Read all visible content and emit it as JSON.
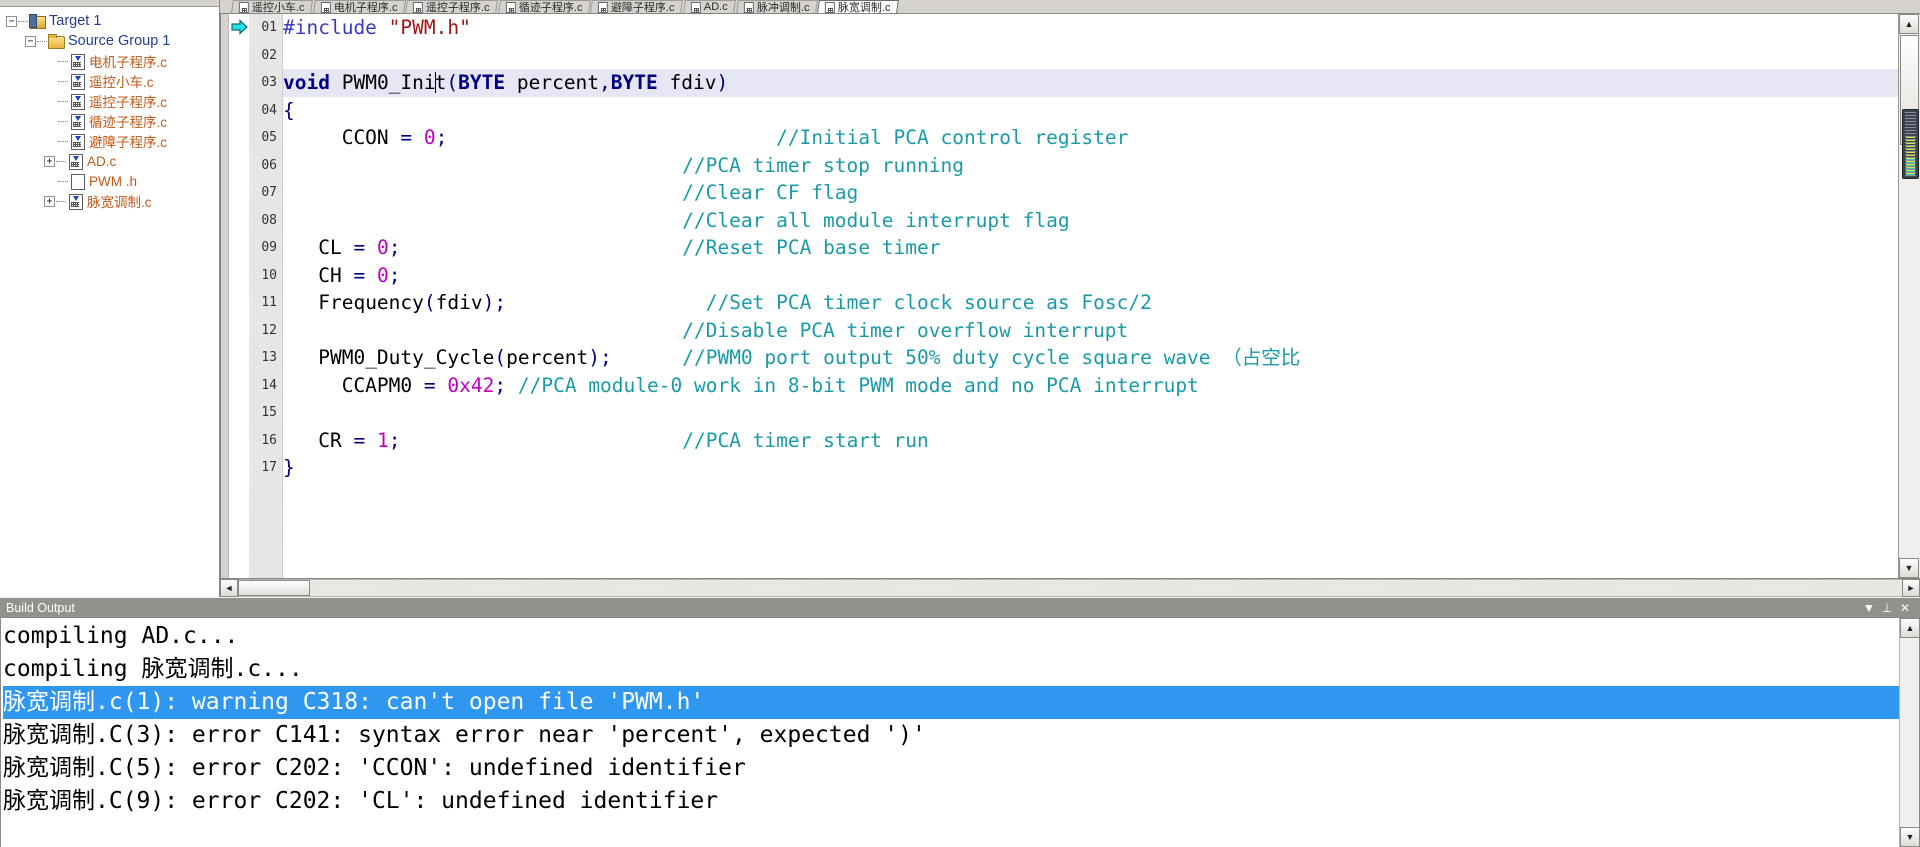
{
  "sidebar": {
    "tree": [
      {
        "label": "Target 1",
        "level": 0,
        "icon": "target-icon",
        "expander": "minus"
      },
      {
        "label": "Source Group 1",
        "level": 1,
        "icon": "folder-icon",
        "expander": "minus"
      },
      {
        "label": "电机子程序.c",
        "level": 2,
        "icon": "c-file-icon",
        "expander": "none"
      },
      {
        "label": "遥控小车.c",
        "level": 2,
        "icon": "c-file-icon",
        "expander": "none"
      },
      {
        "label": "遥控子程序.c",
        "level": 2,
        "icon": "c-file-icon",
        "expander": "none"
      },
      {
        "label": "循迹子程序.c",
        "level": 2,
        "icon": "c-file-icon",
        "expander": "none"
      },
      {
        "label": "避障子程序.c",
        "level": 2,
        "icon": "c-file-icon",
        "expander": "none"
      },
      {
        "label": "AD.c",
        "level": 2,
        "icon": "c-file-icon",
        "expander": "plus"
      },
      {
        "label": "PWM .h",
        "level": 2,
        "icon": "h-file-icon",
        "expander": "none"
      },
      {
        "label": "脉宽调制.c",
        "level": 2,
        "icon": "c-file-icon",
        "expander": "plus"
      }
    ]
  },
  "tabs": [
    {
      "label": "遥控小车.c",
      "active": false
    },
    {
      "label": "电机子程序.c",
      "active": false
    },
    {
      "label": "遥控子程序.c",
      "active": false
    },
    {
      "label": "循迹子程序.c",
      "active": false
    },
    {
      "label": "避障子程序.c",
      "active": false
    },
    {
      "label": "AD.c",
      "active": false
    },
    {
      "label": "脉冲调制.c",
      "active": false
    },
    {
      "label": "脉宽调制.c",
      "active": true
    }
  ],
  "editor": {
    "current_line": 3,
    "exec_marker_line": 1,
    "line_numbers": [
      "01",
      "02",
      "03",
      "04",
      "05",
      "06",
      "07",
      "08",
      "09",
      "10",
      "11",
      "12",
      "13",
      "14",
      "15",
      "16",
      "17"
    ],
    "lines": [
      "#include \"PWM.h\"",
      "",
      "void PWM0_Init(BYTE percent,BYTE fdiv)",
      "{",
      "     CCON = 0;                            //Initial PCA control register",
      "                                  //PCA timer stop running",
      "                                  //Clear CF flag",
      "                                  //Clear all module interrupt flag",
      "   CL = 0;                        //Reset PCA base timer",
      "   CH = 0;",
      "   Frequency(fdiv);                 //Set PCA timer clock source as Fosc/2",
      "                                  //Disable PCA timer overflow interrupt",
      "   PWM0_Duty_Cycle(percent);      //PWM0 port output 50% duty cycle square wave （占空比",
      "     CCAPM0 = 0x42; //PCA module-0 work in 8-bit PWM mode and no PCA interrupt",
      "",
      "   CR = 1;                        //PCA timer start run",
      "}"
    ]
  },
  "build_output": {
    "title": "Build Output",
    "title_buttons": [
      "chevron-down-icon",
      "pin-icon",
      "close-icon"
    ],
    "lines": [
      {
        "text": "compiling AD.c...",
        "selected": false
      },
      {
        "text": "compiling 脉宽调制.c...",
        "selected": false
      },
      {
        "text": "脉宽调制.c(1): warning C318: can't open file 'PWM.h'",
        "selected": true
      },
      {
        "text": "脉宽调制.C(3): error C141: syntax error near 'percent', expected ')'",
        "selected": false
      },
      {
        "text": "脉宽调制.C(5): error C202: 'CCON': undefined identifier",
        "selected": false
      },
      {
        "text": "脉宽调制.C(9): error C202: 'CL': undefined identifier",
        "selected": false
      }
    ]
  },
  "colors": {
    "selection_blue": "#2f97f0",
    "comment_teal": "#1a9aa8",
    "keyword_navy": "#000080",
    "string_red": "#a31515",
    "number_magenta": "#c000c0",
    "tree_orange": "#c05a1a",
    "tree_navy": "#243d8f",
    "current_line": "#e6e6f5",
    "panel_gray": "#93918c",
    "chrome_gray": "#d6d3ce"
  },
  "scrollbars": {
    "v_up": "▲",
    "v_down": "▼",
    "h_left": "◄",
    "h_right": "►"
  }
}
